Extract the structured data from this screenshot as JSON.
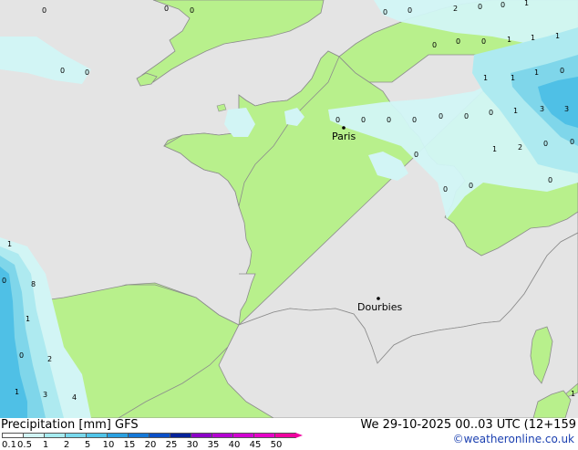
{
  "map": {
    "cities": [
      {
        "name": "Paris"
      },
      {
        "name": "Dourbies"
      }
    ],
    "values": [
      "0",
      "0",
      "0",
      "0",
      "0",
      "2",
      "0",
      "0",
      "1",
      "0",
      "0",
      "0",
      "1",
      "1",
      "1",
      "0",
      "0",
      "1",
      "1",
      "1",
      "0",
      "1",
      "3",
      "3",
      "0",
      "0",
      "0",
      "0",
      "0",
      "0",
      "0",
      "0",
      "1",
      "2",
      "0",
      "0",
      "0",
      "0",
      "0",
      "1",
      "0",
      "8",
      "1",
      "0",
      "2",
      "1",
      "3",
      "4",
      "1"
    ],
    "colors": {
      "sea": "#e4e4e4",
      "land": "#b8f08c",
      "light_rain": "#d2f5f5",
      "rain_1": "#aeeaf0",
      "rain_2": "#7fd6ea",
      "rain_3": "#4fc0e6"
    }
  },
  "footer": {
    "title": "Precipitation [mm]  GFS",
    "datetime": "We 29-10-2025 00..03 UTC (12+159",
    "credit": "©weatheronline.co.uk",
    "legend": {
      "labels": [
        "0.1",
        "0.5",
        "1",
        "2",
        "5",
        "10",
        "15",
        "20",
        "25",
        "30",
        "35",
        "40",
        "45",
        "50"
      ],
      "colors": [
        "#ffffff",
        "#d2f5f5",
        "#a6ebf0",
        "#78d8ec",
        "#50c4e8",
        "#2aa0e0",
        "#1478d8",
        "#0a4fc8",
        "#06229a",
        "#8c00c8",
        "#b400d2",
        "#d200d2",
        "#e600c8",
        "#f000a0"
      ]
    }
  }
}
